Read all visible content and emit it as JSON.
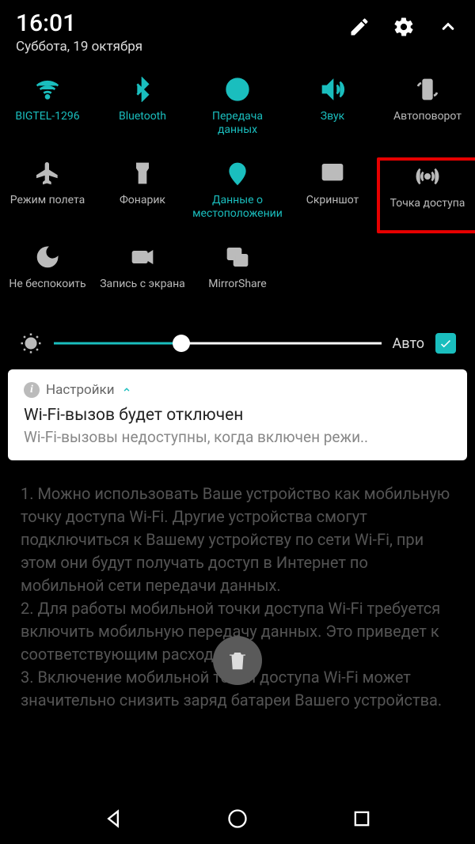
{
  "status": {
    "time": "16:01",
    "date": "Суббота, 19 октября"
  },
  "tiles": [
    {
      "label": "BIGTEL-1296",
      "active": true
    },
    {
      "label": "Bluetooth",
      "active": true
    },
    {
      "label": "Передача данных",
      "active": true
    },
    {
      "label": "Звук",
      "active": true
    },
    {
      "label": "Автоповорот",
      "active": false
    },
    {
      "label": "Режим полета",
      "active": false
    },
    {
      "label": "Фонарик",
      "active": false
    },
    {
      "label": "Данные о местоположении",
      "active": true
    },
    {
      "label": "Скриншот",
      "active": false
    },
    {
      "label": "Точка доступа",
      "active": false,
      "highlighted": true
    },
    {
      "label": "Не беспокоить",
      "active": false
    },
    {
      "label": "Запись с экрана",
      "active": false
    },
    {
      "label": "MirrorShare",
      "active": false
    }
  ],
  "brightness": {
    "auto_label": "Авто",
    "auto_checked": true,
    "value_percent": 39
  },
  "notification": {
    "app": "Настройки",
    "title": "Wi-Fi-вызов будет отключен",
    "body": "Wi-Fi-вызовы недоступны, когда включен режи.."
  },
  "background_text": "1. Можно использовать Ваше устройство как мобильную точку доступа Wi-Fi. Другие устройства смогут подключиться к Вашему устройству по сети Wi-Fi, при этом они будут получать доступ в Интернет по мобильной сети передачи данных.\n2. Для работы мобильной точки доступа Wi-Fi требуется включить мобильную передачу данных. Это приведет к соответствующим расходам.\n3. Включение мобильной точки доступа Wi-Fi может значительно снизить заряд батареи Вашего устройства."
}
